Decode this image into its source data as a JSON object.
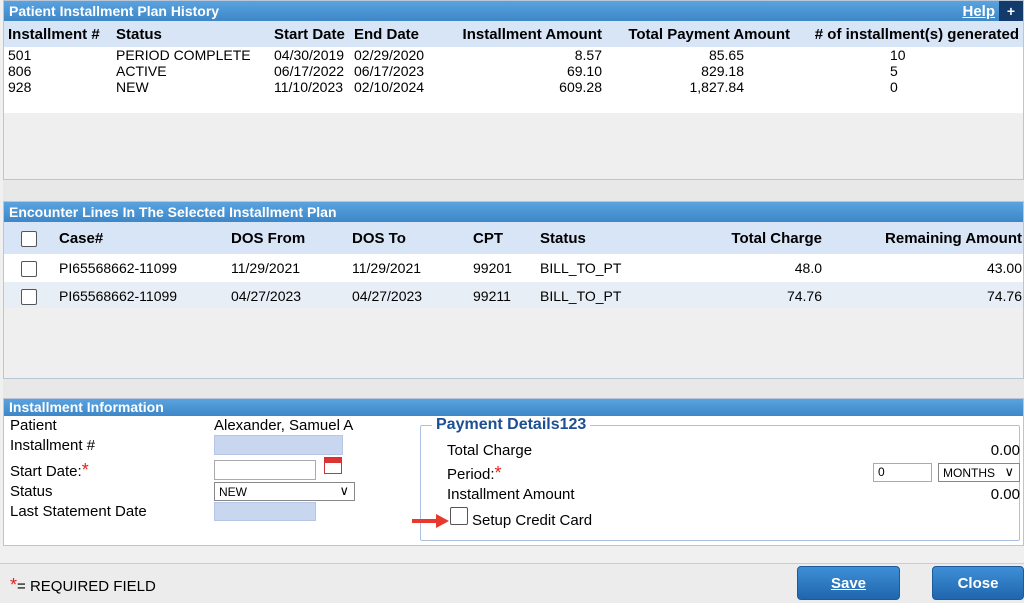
{
  "history": {
    "title": "Patient Installment Plan History",
    "help_label": "Help",
    "plus_label": "+",
    "columns": [
      "Installment #",
      "Status",
      "Start Date",
      "End Date",
      "Installment Amount",
      "Total Payment Amount",
      "# of installment(s) generated"
    ],
    "rows": [
      [
        "501",
        "PERIOD COMPLETE",
        "04/30/2019",
        "02/29/2020",
        "8.57",
        "85.65",
        "10"
      ],
      [
        "806",
        "ACTIVE",
        "06/17/2022",
        "06/17/2023",
        "69.10",
        "829.18",
        "5"
      ],
      [
        "928",
        "NEW",
        "11/10/2023",
        "02/10/2024",
        "609.28",
        "1,827.84",
        "0"
      ]
    ]
  },
  "encounters": {
    "title": "Encounter Lines In The Selected Installment Plan",
    "columns": [
      "Case#",
      "DOS From",
      "DOS To",
      "CPT",
      "Status",
      "Total Charge",
      "Remaining Amount"
    ],
    "rows": [
      [
        "PI65568662-11099",
        "11/29/2021",
        "11/29/2021",
        "99201",
        "BILL_TO_PT",
        "48.0",
        "43.00"
      ],
      [
        "PI65568662-11099",
        "04/27/2023",
        "04/27/2023",
        "99211",
        "BILL_TO_PT",
        "74.76",
        "74.76"
      ]
    ]
  },
  "info": {
    "title": "Installment Information",
    "patient_label": "Patient",
    "patient_value": "Alexander, Samuel A",
    "installment_label": "Installment #",
    "start_date_label": "Start Date:",
    "status_label": "Status",
    "status_value": "NEW",
    "last_statement_label": "Last Statement Date",
    "required_star": "*"
  },
  "payment": {
    "legend": "Payment Details123",
    "total_charge_label": "Total Charge",
    "total_charge_value": "0.00",
    "period_label": "Period:",
    "period_value": "0",
    "period_unit": "MONTHS",
    "installment_amount_label": "Installment Amount",
    "installment_amount_value": "0.00",
    "setup_cc_label": "Setup Credit Card"
  },
  "footer": {
    "required_text": "= REQUIRED FIELD",
    "required_star": "*",
    "save_label": "Save",
    "close_label": "Close"
  }
}
